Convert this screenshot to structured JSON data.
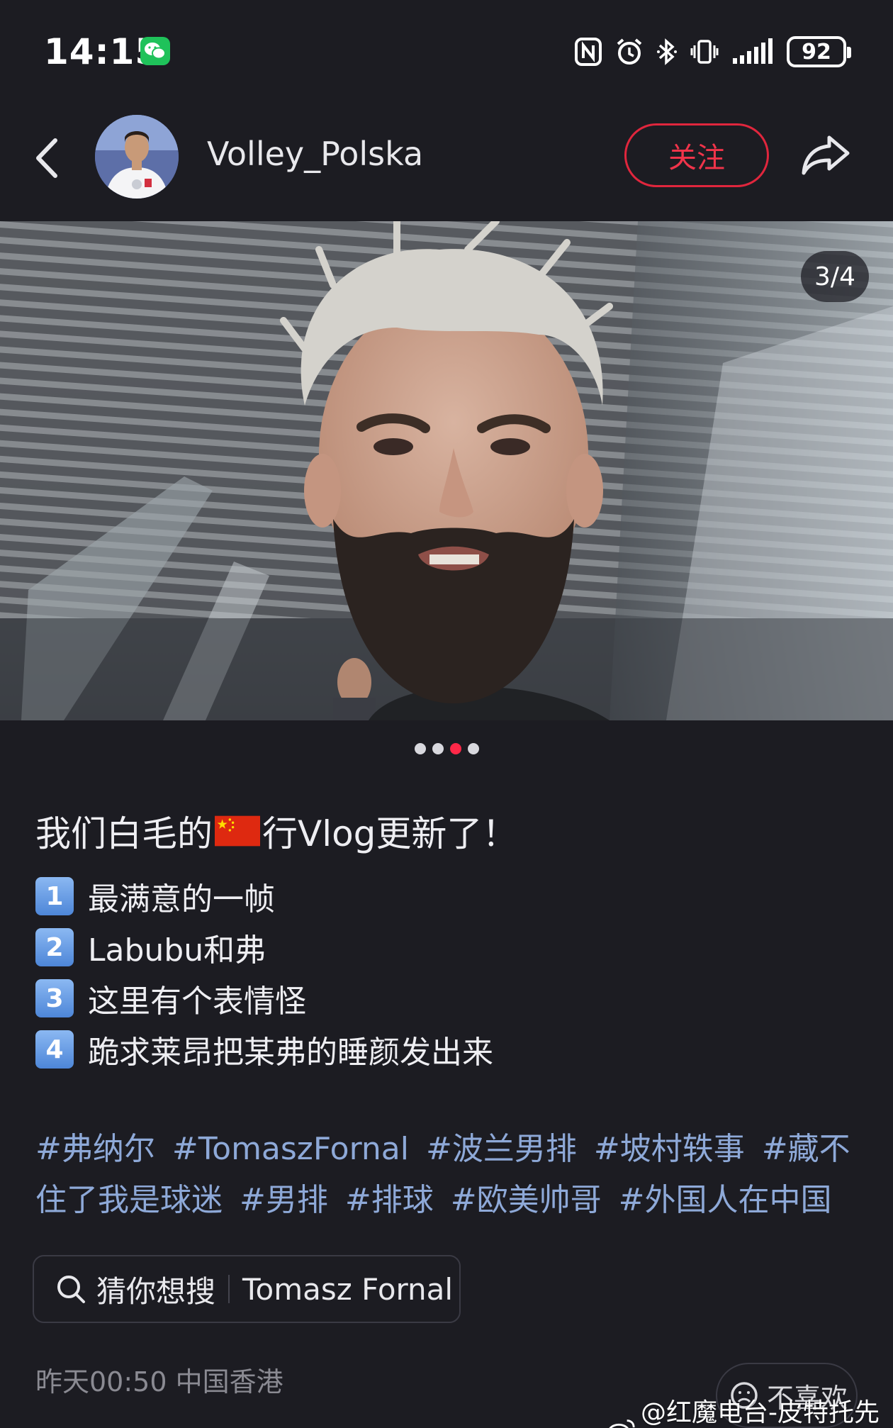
{
  "status_bar": {
    "time": "14:15",
    "battery": "92",
    "icons": [
      "wechat-icon",
      "nfc-icon",
      "alarm-icon",
      "bluetooth-icon",
      "vibrate-icon",
      "signal-icon",
      "battery-icon"
    ]
  },
  "header": {
    "author": "Volley_Polska",
    "follow_label": "关注",
    "icons": [
      "back-icon",
      "share-icon"
    ]
  },
  "media": {
    "counter": "3/4",
    "current_index": 3,
    "total": 4
  },
  "post": {
    "title_before_flag": "我们白毛的",
    "title_after_flag": "行Vlog更新了！",
    "items": [
      {
        "num": "1",
        "text": "最满意的一帧"
      },
      {
        "num": "2",
        "text": "Labubu和弗"
      },
      {
        "num": "3",
        "text": "这里有个表情怪"
      },
      {
        "num": "4",
        "text": "跪求莱昂把某弗的睡颜发出来"
      }
    ],
    "tags": [
      "#弗纳尔",
      "#TomaszFornal",
      "#波兰男排",
      "#坡村轶事",
      "#藏不住了我是球迷",
      "#男排",
      "#排球",
      "#欧美帅哥",
      "#外国人在中国"
    ]
  },
  "search_suggestion": {
    "label": "猜你想搜",
    "query": "Tomasz Fornal"
  },
  "meta": {
    "time_location": "昨天00:50 中国香港",
    "dislike_label": "不喜欢"
  },
  "watermark": "@红魔电台-皮特托先生",
  "colors": {
    "background": "#1c1c22",
    "accent": "#e0263d",
    "tag": "#8ea9d8",
    "active_dot": "#ff2848"
  }
}
